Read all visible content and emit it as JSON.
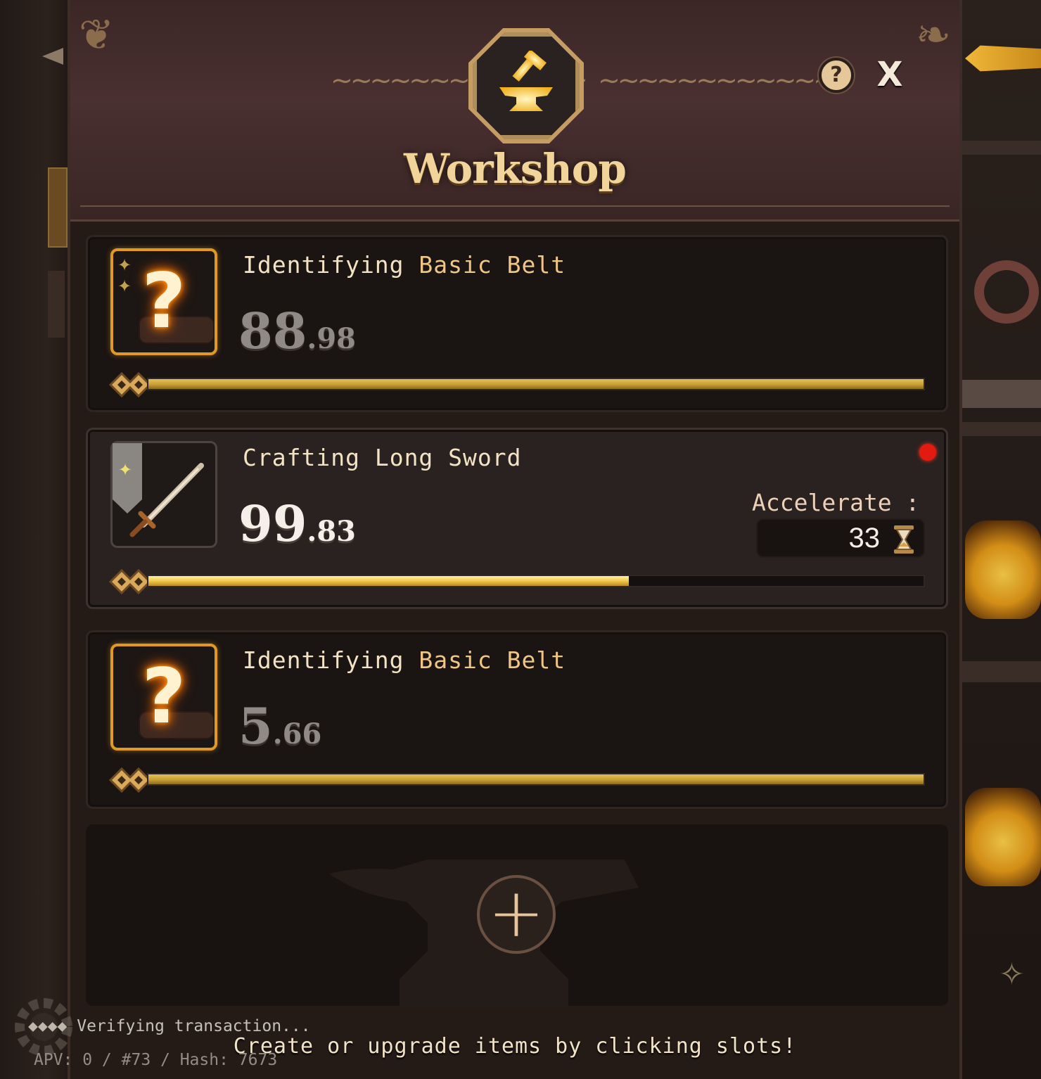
{
  "header": {
    "title": "Workshop",
    "help_symbol": "?",
    "close_symbol": "X",
    "emblem_icon": "anvil-hammer-icon"
  },
  "slots": [
    {
      "action": "Identifying",
      "item": "Basic Belt",
      "timer_whole": "88",
      "timer_fraction": ".98",
      "progress": 1.0,
      "icon": "unknown-belt-icon"
    },
    {
      "action": "Crafting",
      "item": "Long Sword",
      "timer_whole": "99",
      "timer_fraction": ".83",
      "progress": 0.62,
      "icon": "long-sword-icon",
      "accelerate_label": "Accelerate :",
      "accelerate_cost": "33",
      "accelerate_icon": "hourglass-icon",
      "notification": true
    },
    {
      "action": "Identifying",
      "item": "Basic Belt",
      "timer_whole": "5",
      "timer_fraction": ".66",
      "progress": 1.0,
      "icon": "unknown-belt-icon"
    }
  ],
  "empty_slot": {
    "add_symbol": "+"
  },
  "hint": "Create or upgrade items by clicking slots!",
  "system": {
    "verifying": "Verifying transaction...",
    "apv": "APV: 0 / #73 / Hash: 7673"
  },
  "colors": {
    "accent_gold": "#e09a22",
    "progress_gold": "#c89f32",
    "notification_red": "#e21a10"
  }
}
